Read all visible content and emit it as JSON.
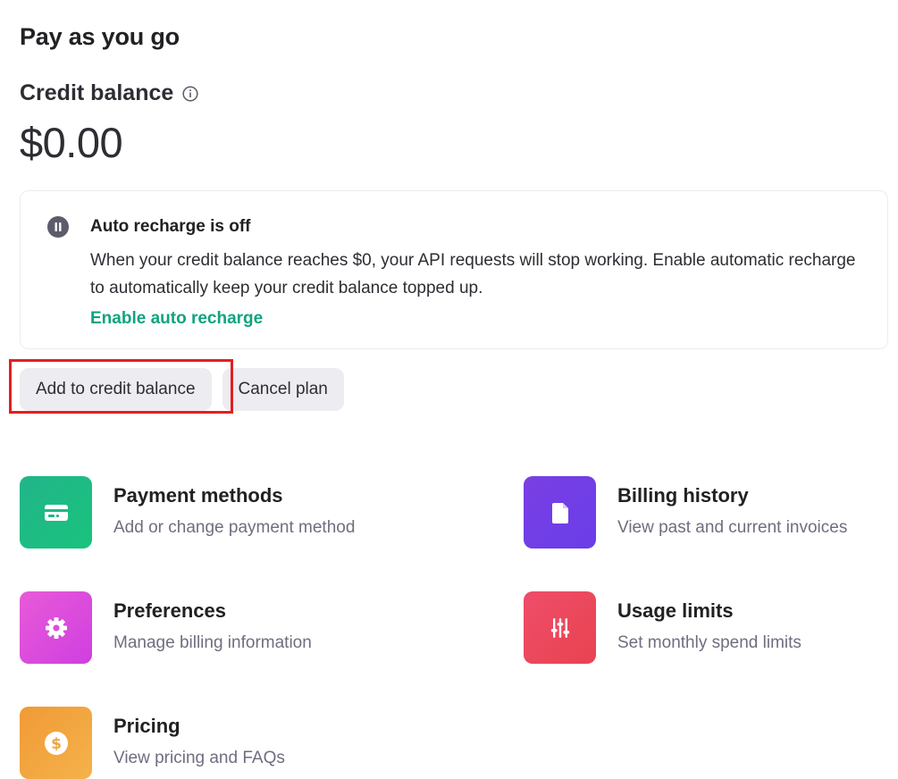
{
  "page": {
    "title": "Pay as you go"
  },
  "credit": {
    "section_title": "Credit balance",
    "balance": "$0.00"
  },
  "auto_recharge": {
    "title": "Auto recharge is off",
    "body": "When your credit balance reaches $0, your API requests will stop working. Enable automatic recharge to automatically keep your credit balance topped up.",
    "link_label": "Enable auto recharge",
    "link_color": "#10a37f"
  },
  "actions": {
    "add_credit_label": "Add to credit balance",
    "cancel_plan_label": "Cancel plan"
  },
  "cards": [
    {
      "title": "Payment methods",
      "description": "Add or change payment method",
      "icon": "credit-card-icon",
      "colors": [
        "#21b88a",
        "#19c37d"
      ]
    },
    {
      "title": "Billing history",
      "description": "View past and current invoices",
      "icon": "document-icon",
      "colors": [
        "#7b3fe4",
        "#6a3de8"
      ]
    },
    {
      "title": "Preferences",
      "description": "Manage billing information",
      "icon": "gear-icon",
      "colors": [
        "#e85ad8",
        "#d03fe0"
      ]
    },
    {
      "title": "Usage limits",
      "description": "Set monthly spend limits",
      "icon": "sliders-icon",
      "colors": [
        "#ef4d6b",
        "#e8434f"
      ]
    },
    {
      "title": "Pricing",
      "description": "View pricing and FAQs",
      "icon": "dollar-icon",
      "colors": [
        "#f0a13c",
        "#f5b24c"
      ]
    }
  ]
}
